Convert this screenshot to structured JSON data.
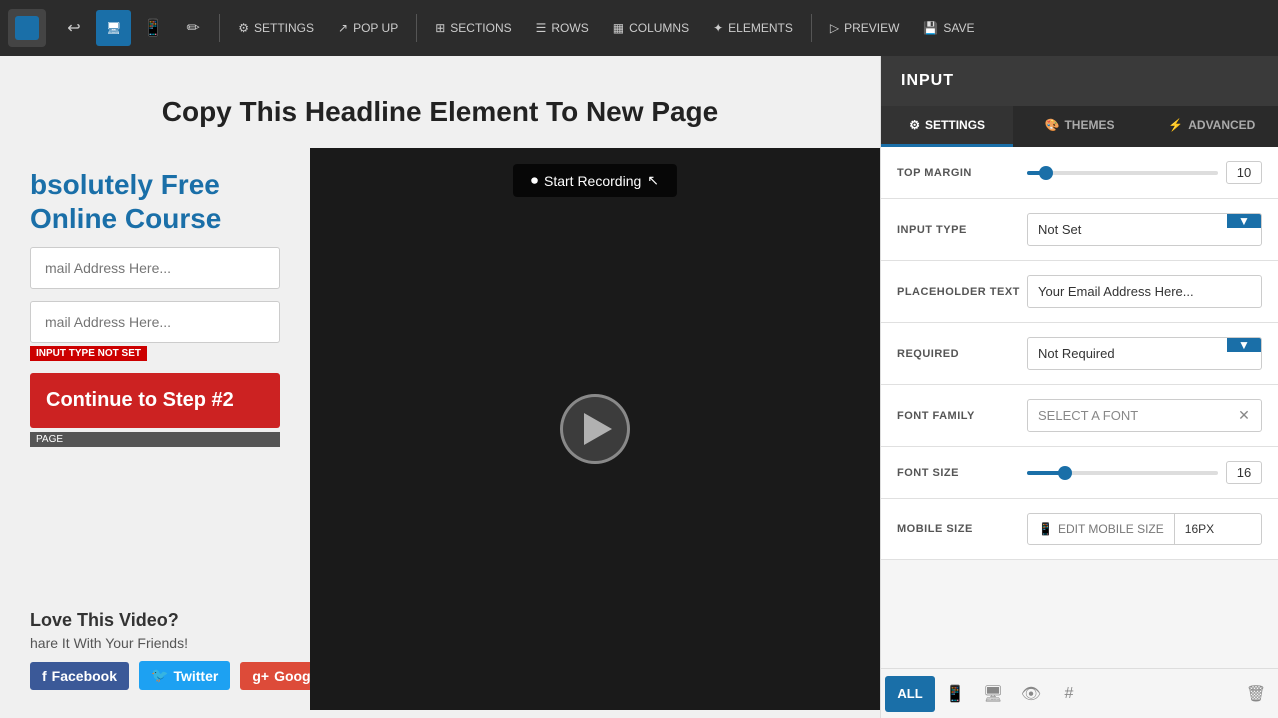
{
  "toolbar": {
    "undo_label": "↩",
    "device_desktop_label": "🖥",
    "device_mobile_label": "📱",
    "pen_label": "✏",
    "settings_label": "SETTINGS",
    "popup_label": "POP UP",
    "sections_label": "SECTIONS",
    "rows_label": "ROWS",
    "columns_label": "COLUMNS",
    "elements_label": "ELEMENTS",
    "preview_label": "PREVIEW",
    "save_label": "SAVE"
  },
  "canvas": {
    "headline": "Copy This Headline Element To New Page",
    "free_course_line1": "bsolutely Free",
    "free_course_line2": "Online Course",
    "email_placeholder1": "mail Address Here...",
    "email_placeholder2": "mail Address Here...",
    "input_error_badge": "INPUT TYPE NOT SET",
    "cta_button": "Continue to Step #2",
    "page_badge": "PAGE",
    "share_title": "Love This Video?",
    "share_subtitle": "hare It With Your Friends!",
    "facebook_label": "Facebook",
    "twitter_label": "Twitter",
    "google_label": "Google+",
    "video_start_recording": "Start Recording",
    "video_cursor": "▶"
  },
  "right_panel": {
    "header_title": "INPUT",
    "tab_settings": "SETTINGS",
    "tab_themes": "THEMES",
    "tab_advanced": "ADVANCED",
    "top_margin_label": "TOP MARGIN",
    "top_margin_value": "10",
    "top_margin_percent": "10",
    "input_type_label": "INPUT TYPE",
    "input_type_value": "Not Set",
    "placeholder_text_label": "PLACEHOLDER TEXT",
    "placeholder_text_value": "Your Email Address Here...",
    "required_label": "REQUIRED",
    "required_value": "Not Required",
    "font_family_label": "FONT FAMILY",
    "font_family_value": "SELECT A FONT",
    "font_size_label": "FONT SIZE",
    "font_size_value": "16",
    "font_size_percent": "20",
    "mobile_size_label": "MOBILE SIZE",
    "mobile_size_edit": "EDIT MOBILE SIZE",
    "mobile_size_value": "16PX"
  },
  "bottom_bar": {
    "all_label": "ALL",
    "mobile_icon": "📱",
    "desktop_icon": "🖥",
    "eye_icon": "👁",
    "hash_icon": "#",
    "trash_icon": "🗑"
  }
}
